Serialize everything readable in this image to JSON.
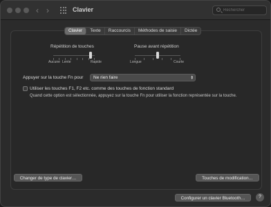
{
  "window": {
    "title": "Clavier"
  },
  "toolbar": {
    "back_icon": "‹",
    "forward_icon": "›"
  },
  "search": {
    "placeholder": "Rechercher"
  },
  "tabs": [
    {
      "label": "Clavier",
      "active": true
    },
    {
      "label": "Texte"
    },
    {
      "label": "Raccourcis"
    },
    {
      "label": "Méthodes de saisie"
    },
    {
      "label": "Dictée"
    }
  ],
  "key_repeat": {
    "title": "Répétition de touches",
    "labels": [
      "Aucune",
      "Lente",
      "Rapide"
    ],
    "position": 0.9,
    "ticks": 8
  },
  "delay_until_repeat": {
    "title": "Pause avant répétition",
    "labels": [
      "Longue",
      "Courte"
    ],
    "position": 0.5,
    "ticks": 6
  },
  "fn_key": {
    "label": "Appuyer sur la touche Fn pour",
    "value": "Ne rien faire"
  },
  "fkeys": {
    "label": "Utiliser les touches F1, F2 etc. comme des touches de fonction standard",
    "description": "Quand cette option est sélectionnée, appuyez sur la touche Fn pour utiliser la fonction représentée sur la touche.",
    "checked": false
  },
  "buttons": {
    "change_type": "Changer de type de clavier…",
    "modifier_keys": "Touches de modification…",
    "bluetooth": "Configurer un clavier Bluetooth…",
    "help": "?"
  }
}
